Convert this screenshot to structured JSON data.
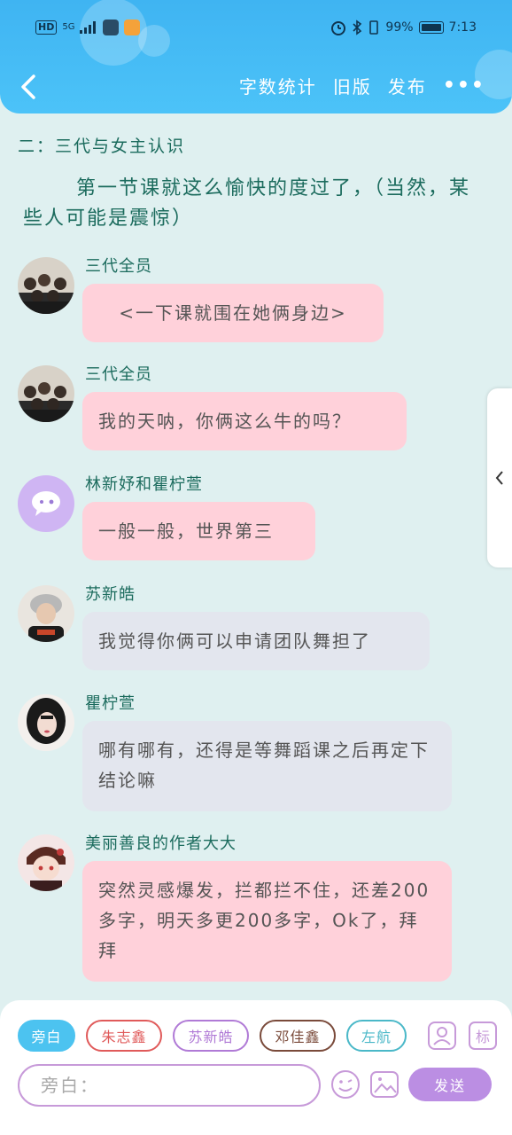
{
  "status_bar": {
    "hd": "HD",
    "signal": "5G",
    "battery_text": "99%",
    "time": "7:13",
    "battery_level": 0.99
  },
  "nav": {
    "word_count": "字数统计",
    "old_version": "旧版",
    "publish": "发布",
    "more": "•••"
  },
  "content": {
    "chapter_title": "二：三代与女主认识",
    "narration": "第一节课就这么愉快的度过了，（当然，某些人可能是震惊）",
    "messages": [
      {
        "name": "三代全员",
        "text": "<一下课就围在她俩身边>",
        "style": "pink"
      },
      {
        "name": "三代全员",
        "text": "我的天呐，你俩这么牛的吗？",
        "style": "pink"
      },
      {
        "name": "林新妤和瞿柠萱",
        "text": "一般一般，世界第三",
        "style": "pink"
      },
      {
        "name": "苏新皓",
        "text": "我觉得你俩可以申请团队舞担了",
        "style": "grey"
      },
      {
        "name": "瞿柠萱",
        "text": "哪有哪有，还得是等舞蹈课之后再定下结论嘛",
        "style": "grey"
      },
      {
        "name": "美丽善良的作者大大",
        "text": "突然灵感爆发，拦都拦不住，还差200多字，明天多更200多字，Ok了，拜拜",
        "style": "pink"
      }
    ]
  },
  "bottom": {
    "chips": [
      {
        "label": "旁白",
        "active": true,
        "color": "#4cc3f0"
      },
      {
        "label": "朱志鑫",
        "active": false,
        "color": "#e05a5a"
      },
      {
        "label": "苏新皓",
        "active": false,
        "color": "#b07ad6"
      },
      {
        "label": "邓佳鑫",
        "active": false,
        "color": "#7a4a3a"
      },
      {
        "label": "左航",
        "active": false,
        "color": "#4ab8c8"
      }
    ],
    "input_placeholder": "旁白：",
    "send_label": "发送",
    "tag_icon_label": "标"
  },
  "colors": {
    "header": "#47bdf5",
    "background": "#dff0f0",
    "pink_bubble": "#ffd1da",
    "grey_bubble": "#e3e6ee",
    "name_text": "#1b6b5d",
    "send_button": "#bb8ee3"
  }
}
